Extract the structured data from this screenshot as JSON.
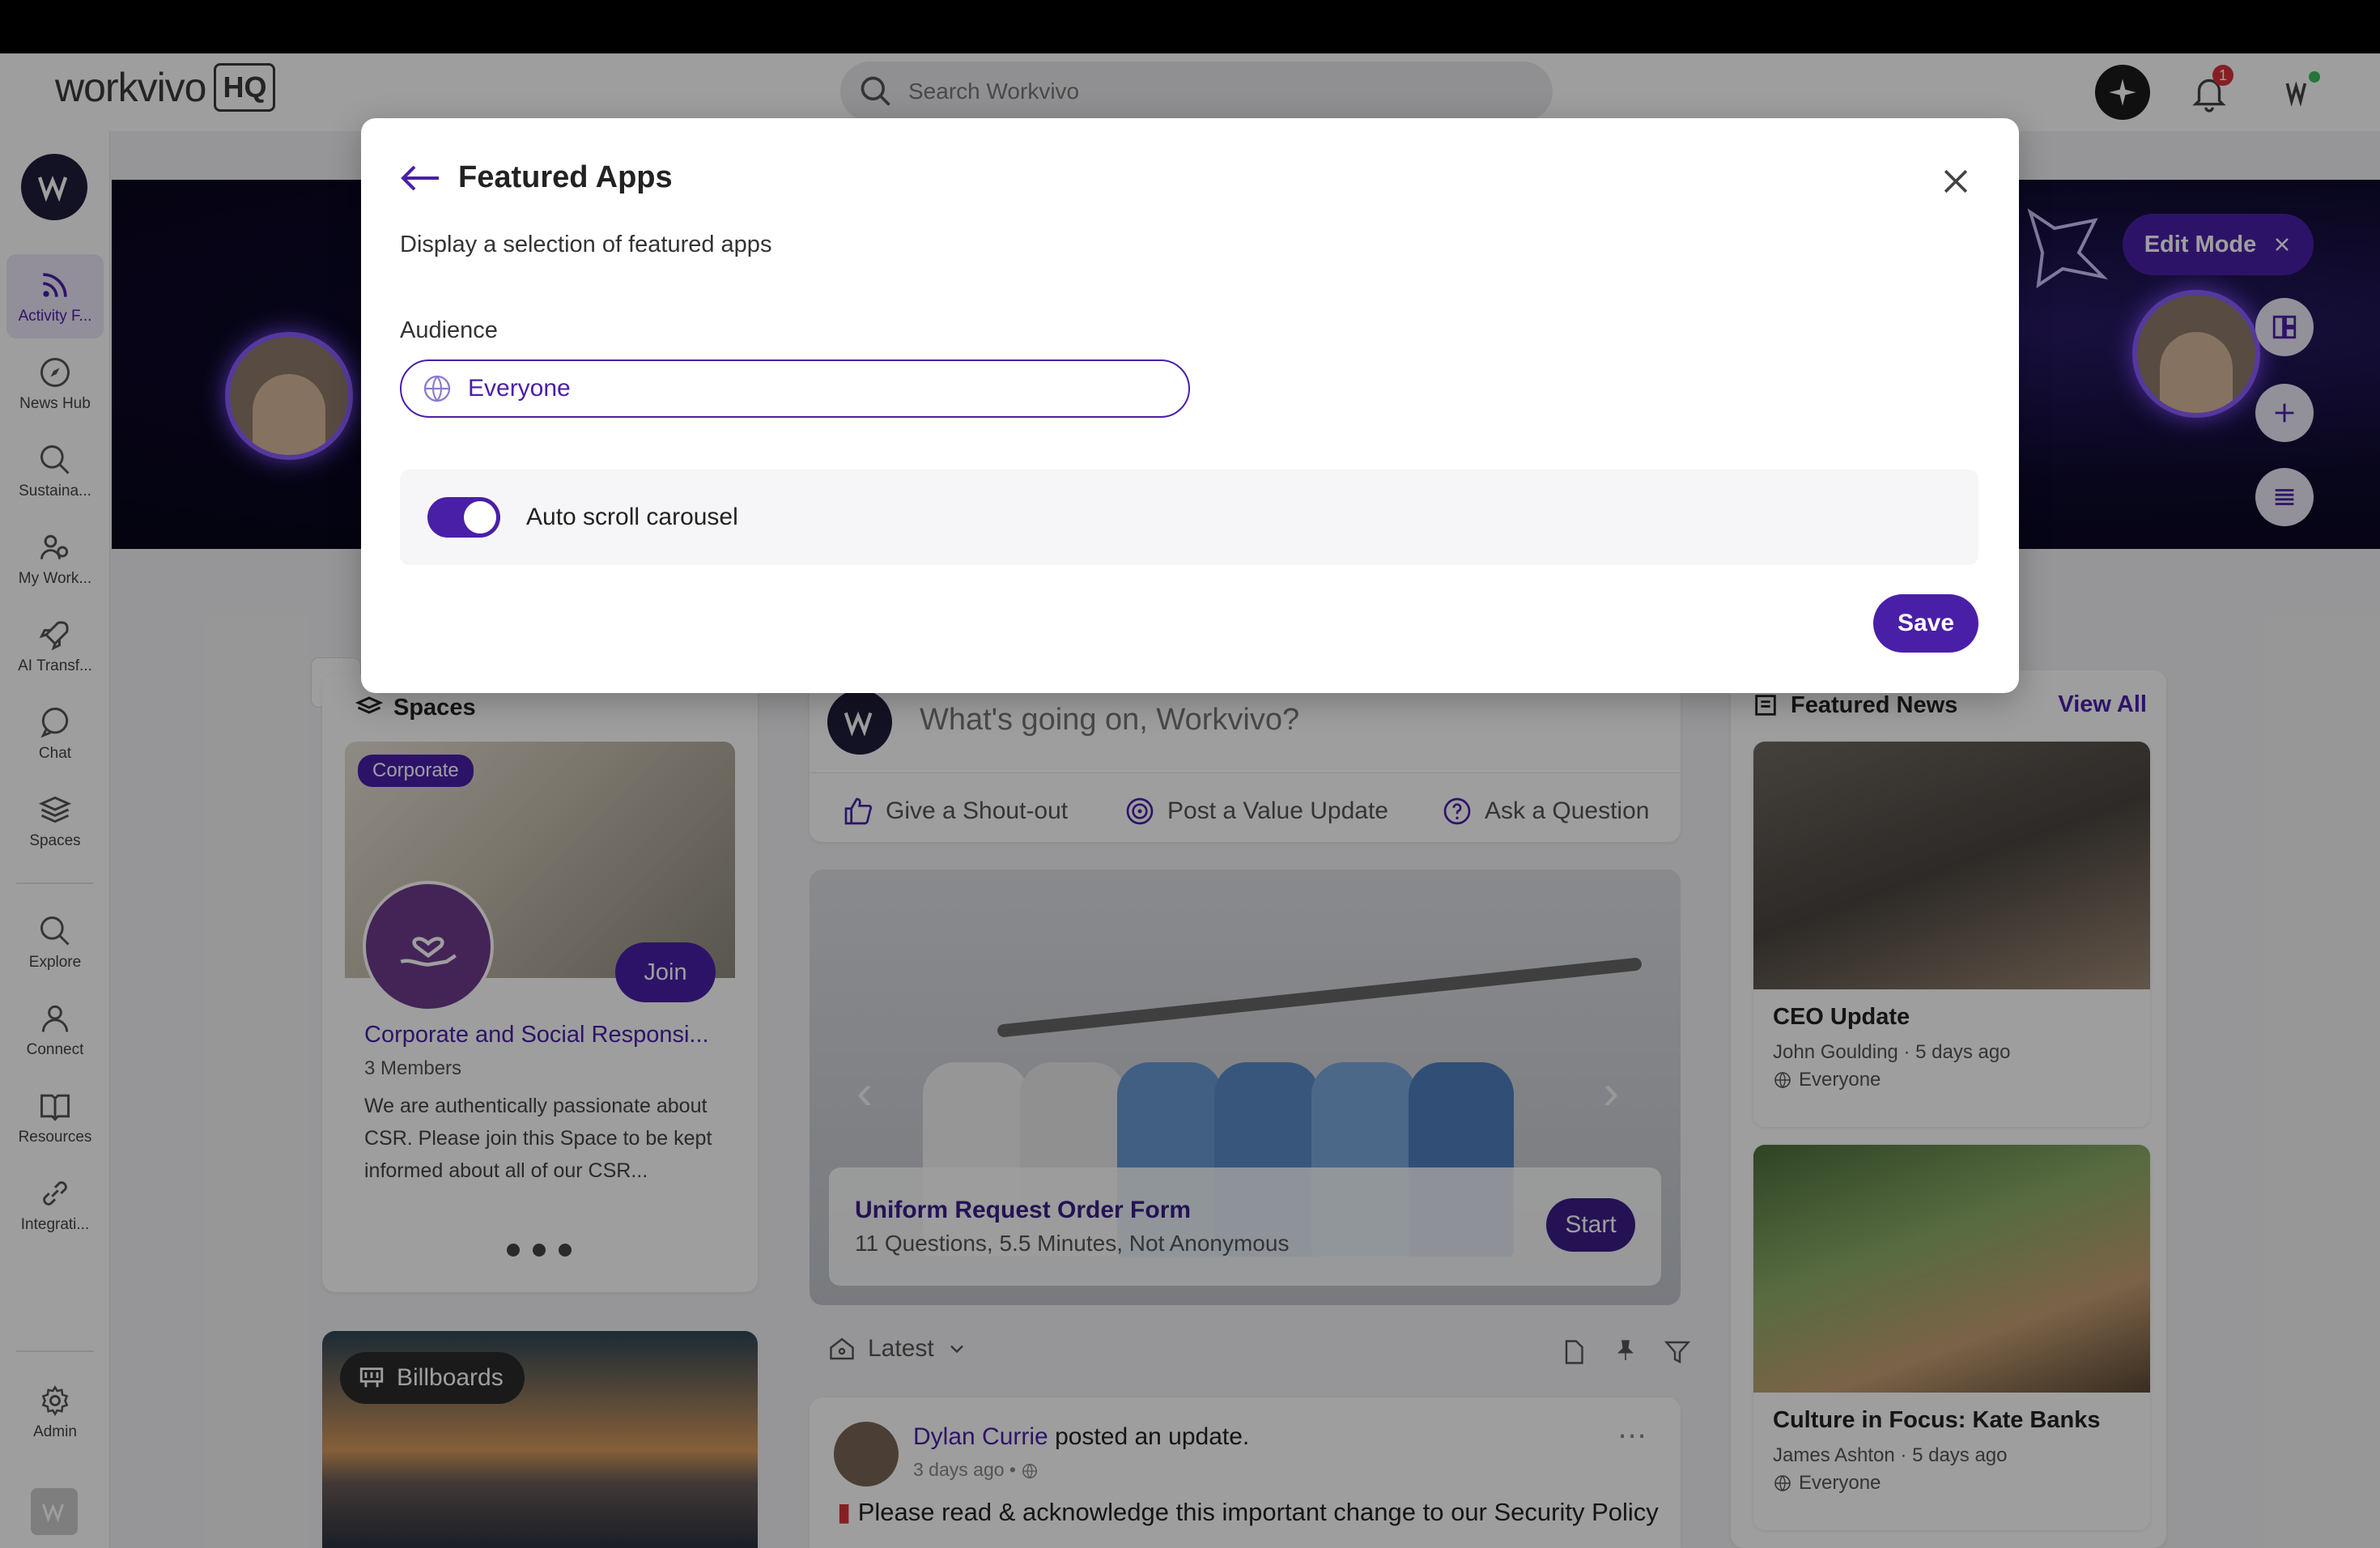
{
  "brand": {
    "logo_word": "workvivo",
    "logo_badge": "HQ"
  },
  "search": {
    "placeholder": "Search Workvivo"
  },
  "notifications": {
    "badge_count": "1"
  },
  "sidebar": {
    "items": [
      {
        "label": "Activity F...",
        "icon": "activity-feed-icon"
      },
      {
        "label": "News Hub",
        "icon": "compass-icon"
      },
      {
        "label": "Sustaina...",
        "icon": "search-icon"
      },
      {
        "label": "My Work...",
        "icon": "people-icon"
      },
      {
        "label": "AI Transf...",
        "icon": "rocket-icon"
      },
      {
        "label": "Chat",
        "icon": "chat-icon"
      },
      {
        "label": "Spaces",
        "icon": "layers-icon"
      },
      {
        "label": "Explore",
        "icon": "search-icon"
      },
      {
        "label": "Connect",
        "icon": "person-icon"
      },
      {
        "label": "Resources",
        "icon": "book-icon"
      },
      {
        "label": "Integrati...",
        "icon": "link-icon"
      },
      {
        "label": "Admin",
        "icon": "gear-icon"
      }
    ]
  },
  "hero": {
    "edit_mode_label": "Edit Mode"
  },
  "spaces": {
    "heading": "Spaces",
    "tag": "Corporate",
    "join_label": "Join",
    "title": "Corporate and Social Responsi...",
    "members": "3 Members",
    "description": "We are authentically passionate about CSR. Please join this Space to be kept informed about all of our CSR..."
  },
  "billboards": {
    "label": "Billboards"
  },
  "composer": {
    "placeholder": "What's going on, Workvivo?",
    "actions": [
      "Give a Shout-out",
      "Post a Value Update",
      "Ask a Question"
    ]
  },
  "featured_app": {
    "title": "Uniform Request Order Form",
    "subtitle": "11 Questions, 5.5 Minutes, Not Anonymous",
    "start_label": "Start"
  },
  "feed": {
    "sort_label": "Latest",
    "post": {
      "author": "Dylan Currie",
      "action": "posted an update.",
      "time": "3 days ago",
      "text": "Please read & acknowledge this important change to our Security Policy"
    }
  },
  "featured_news": {
    "heading": "Featured News",
    "view_all": "View All",
    "items": [
      {
        "title": "CEO Update",
        "meta": "John Goulding · 5 days ago",
        "audience": "Everyone"
      },
      {
        "title": "Culture in Focus: Kate Banks",
        "meta": "James Ashton · 5 days ago",
        "audience": "Everyone"
      }
    ]
  },
  "modal": {
    "title": "Featured Apps",
    "description": "Display a selection of featured apps",
    "audience_label": "Audience",
    "audience_value": "Everyone",
    "toggle_label": "Auto scroll carousel",
    "toggle_on": true,
    "save_label": "Save"
  },
  "colors": {
    "accent": "#4a1fa8",
    "overlay": "rgba(0,0,0,0.38)"
  }
}
